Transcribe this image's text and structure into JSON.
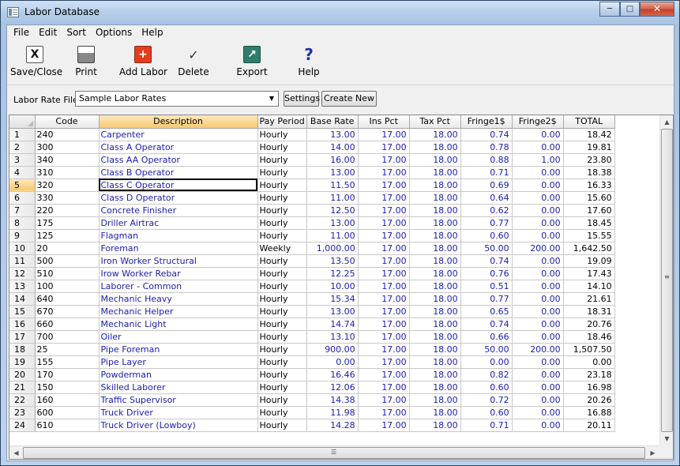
{
  "window": {
    "title": "Labor Database"
  },
  "menu": [
    "File",
    "Edit",
    "Sort",
    "Options",
    "Help"
  ],
  "toolbar": {
    "save_close": "Save/Close",
    "print": "Print",
    "add_labor": "Add Labor",
    "delete": "Delete",
    "export": "Export",
    "help": "Help"
  },
  "ratebar": {
    "label": "Labor Rate File:",
    "selected": "Sample Labor Rates",
    "settings": "Settings",
    "create_new": "Create New"
  },
  "grid": {
    "columns": [
      "Code",
      "Description",
      "Pay Period",
      "Base Rate",
      "Ins Pct",
      "Tax Pct",
      "Fringe1$",
      "Fringe2$",
      "TOTAL"
    ],
    "selected_column": "Description",
    "selected_row": 5,
    "rows": [
      [
        "240",
        "Carpenter",
        "Hourly",
        "13.00",
        "17.00",
        "18.00",
        "0.74",
        "0.00",
        "18.42"
      ],
      [
        "300",
        "Class A Operator",
        "Hourly",
        "14.00",
        "17.00",
        "18.00",
        "0.78",
        "0.00",
        "19.81"
      ],
      [
        "340",
        "Class AA Operator",
        "Hourly",
        "16.00",
        "17.00",
        "18.00",
        "0.88",
        "1.00",
        "23.80"
      ],
      [
        "310",
        "Class B Operator",
        "Hourly",
        "13.00",
        "17.00",
        "18.00",
        "0.71",
        "0.00",
        "18.38"
      ],
      [
        "320",
        "Class C Operator",
        "Hourly",
        "11.50",
        "17.00",
        "18.00",
        "0.69",
        "0.00",
        "16.33"
      ],
      [
        "330",
        "Class D Operator",
        "Hourly",
        "11.00",
        "17.00",
        "18.00",
        "0.64",
        "0.00",
        "15.60"
      ],
      [
        "220",
        "Concrete Finisher",
        "Hourly",
        "12.50",
        "17.00",
        "18.00",
        "0.62",
        "0.00",
        "17.60"
      ],
      [
        "175",
        "Driller Airtrac",
        "Hourly",
        "13.00",
        "17.00",
        "18.00",
        "0.77",
        "0.00",
        "18.45"
      ],
      [
        "125",
        "Flagman",
        "Hourly",
        "11.00",
        "17.00",
        "18.00",
        "0.60",
        "0.00",
        "15.55"
      ],
      [
        "20",
        "Foreman",
        "Weekly",
        "1,000.00",
        "17.00",
        "18.00",
        "50.00",
        "200.00",
        "1,642.50"
      ],
      [
        "500",
        "Iron Worker Structural",
        "Hourly",
        "13.50",
        "17.00",
        "18.00",
        "0.74",
        "0.00",
        "19.09"
      ],
      [
        "510",
        "Irow Worker Rebar",
        "Hourly",
        "12.25",
        "17.00",
        "18.00",
        "0.76",
        "0.00",
        "17.43"
      ],
      [
        "100",
        "Laborer - Common",
        "Hourly",
        "10.00",
        "17.00",
        "18.00",
        "0.51",
        "0.00",
        "14.10"
      ],
      [
        "640",
        "Mechanic Heavy",
        "Hourly",
        "15.34",
        "17.00",
        "18.00",
        "0.77",
        "0.00",
        "21.61"
      ],
      [
        "670",
        "Mechanic Helper",
        "Hourly",
        "13.00",
        "17.00",
        "18.00",
        "0.65",
        "0.00",
        "18.31"
      ],
      [
        "660",
        "Mechanic Light",
        "Hourly",
        "14.74",
        "17.00",
        "18.00",
        "0.74",
        "0.00",
        "20.76"
      ],
      [
        "700",
        "Oiler",
        "Hourly",
        "13.10",
        "17.00",
        "18.00",
        "0.66",
        "0.00",
        "18.46"
      ],
      [
        "25",
        "Pipe Foreman",
        "Hourly",
        "900.00",
        "17.00",
        "18.00",
        "50.00",
        "200.00",
        "1,507.50"
      ],
      [
        "155",
        "Pipe Layer",
        "Hourly",
        "0.00",
        "17.00",
        "18.00",
        "0.00",
        "0.00",
        "0.00"
      ],
      [
        "170",
        "Powderman",
        "Hourly",
        "16.46",
        "17.00",
        "18.00",
        "0.82",
        "0.00",
        "23.18"
      ],
      [
        "150",
        "Skilled Laborer",
        "Hourly",
        "12.06",
        "17.00",
        "18.00",
        "0.60",
        "0.00",
        "16.98"
      ],
      [
        "160",
        "Traffic Supervisor",
        "Hourly",
        "14.38",
        "17.00",
        "18.00",
        "0.72",
        "0.00",
        "20.26"
      ],
      [
        "600",
        "Truck Driver",
        "Hourly",
        "11.98",
        "17.00",
        "18.00",
        "0.60",
        "0.00",
        "16.88"
      ],
      [
        "610",
        "Truck Driver (Lowboy)",
        "Hourly",
        "14.28",
        "17.00",
        "18.00",
        "0.71",
        "0.00",
        "20.11"
      ]
    ]
  },
  "icons": {
    "app": "database-window-icon",
    "save_close": "save-close-icon",
    "print": "printer-icon",
    "add_labor": "add-labor-icon",
    "delete": "delete-icon",
    "export": "export-icon",
    "help": "help-icon"
  },
  "colors": {
    "accent_header": "#f7c96e",
    "cell_text": "#1b1bb0"
  }
}
